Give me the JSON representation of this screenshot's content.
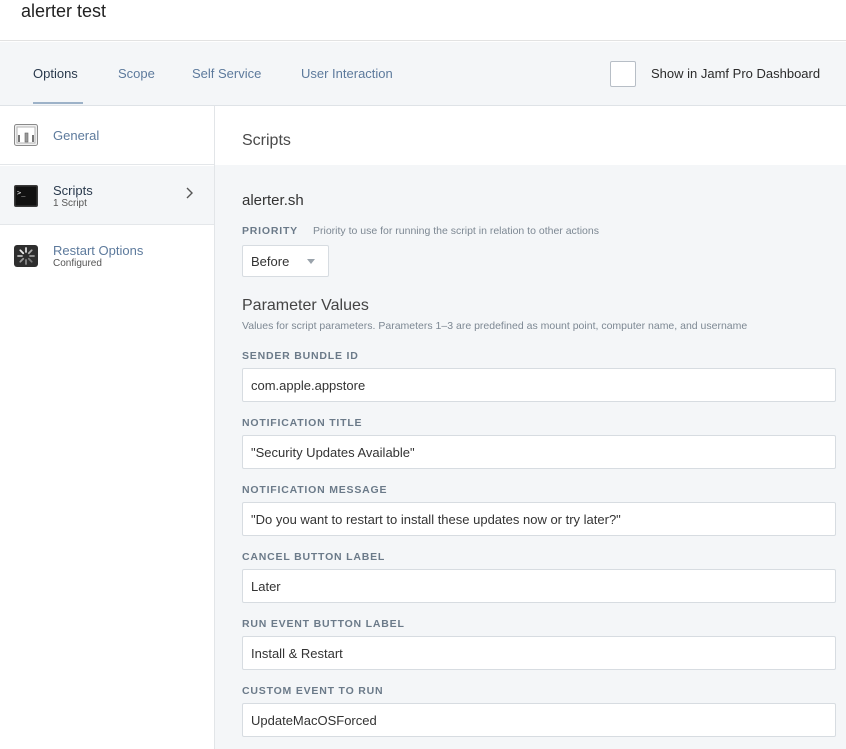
{
  "page": {
    "title": "alerter test"
  },
  "tabs": [
    {
      "label": "Options",
      "active": true
    },
    {
      "label": "Scope",
      "active": false
    },
    {
      "label": "Self Service",
      "active": false
    },
    {
      "label": "User Interaction",
      "active": false
    }
  ],
  "dashboard_toggle": {
    "label": "Show in Jamf Pro Dashboard",
    "checked": false
  },
  "sidebar": {
    "items": [
      {
        "label": "General",
        "subtitle": "",
        "icon": "general-icon"
      },
      {
        "label": "Scripts",
        "subtitle": "1 Script",
        "icon": "terminal-icon",
        "active": true
      },
      {
        "label": "Restart Options",
        "subtitle": "Configured",
        "icon": "restart-icon"
      }
    ]
  },
  "main": {
    "header": "Scripts",
    "script_name": "alerter.sh",
    "priority": {
      "label": "PRIORITY",
      "hint": "Priority to use for running the script in relation to other actions",
      "value": "Before"
    },
    "params": {
      "title": "Parameter Values",
      "description": "Values for script parameters. Parameters 1–3 are predefined as mount point, computer name, and username",
      "fields": [
        {
          "label": "SENDER BUNDLE ID",
          "value": "com.apple.appstore"
        },
        {
          "label": "NOTIFICATION TITLE",
          "value": "\"Security Updates Available\""
        },
        {
          "label": "NOTIFICATION MESSAGE",
          "value": "\"Do you want to restart to install these updates now or try later?\""
        },
        {
          "label": "CANCEL BUTTON LABEL",
          "value": "Later"
        },
        {
          "label": "RUN EVENT BUTTON LABEL",
          "value": "Install & Restart"
        },
        {
          "label": "CUSTOM EVENT TO RUN",
          "value": "UpdateMacOSForced"
        }
      ]
    }
  },
  "colors": {
    "accent": "#5d7a9c",
    "panel_bg": "#f4f6f8"
  }
}
